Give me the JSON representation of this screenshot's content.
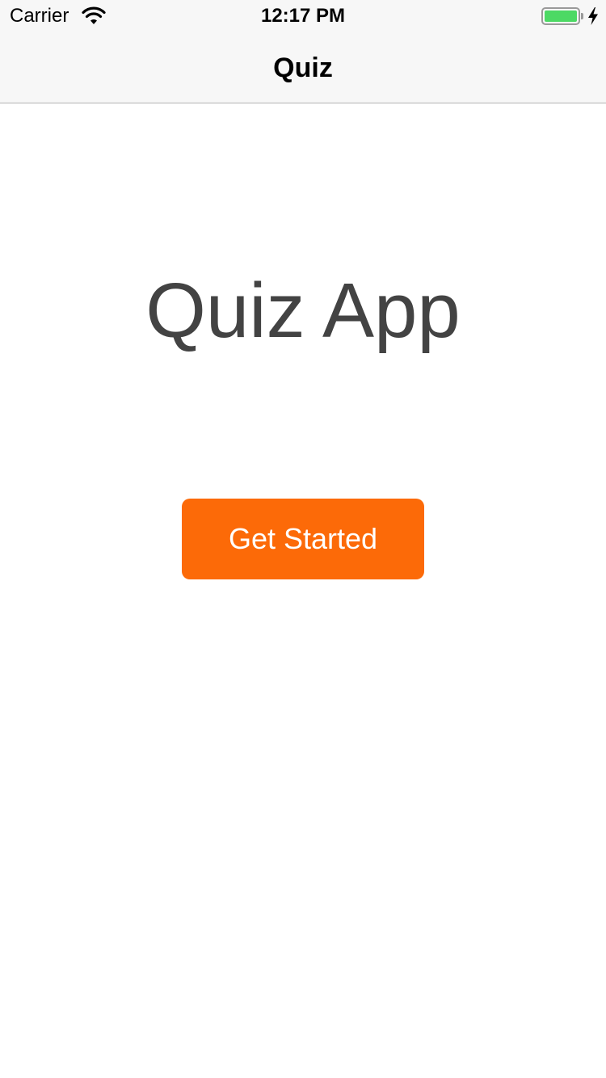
{
  "status_bar": {
    "carrier": "Carrier",
    "time": "12:17 PM",
    "wifi_icon": "wifi-icon",
    "battery_icon": "battery-icon",
    "charging_icon": "lightning-bolt-icon",
    "battery_level": 1.0,
    "battery_color": "#4cd964"
  },
  "nav": {
    "title": "Quiz"
  },
  "main": {
    "headline": "Quiz App",
    "button_label": "Get Started",
    "button_color": "#fc6a08"
  }
}
